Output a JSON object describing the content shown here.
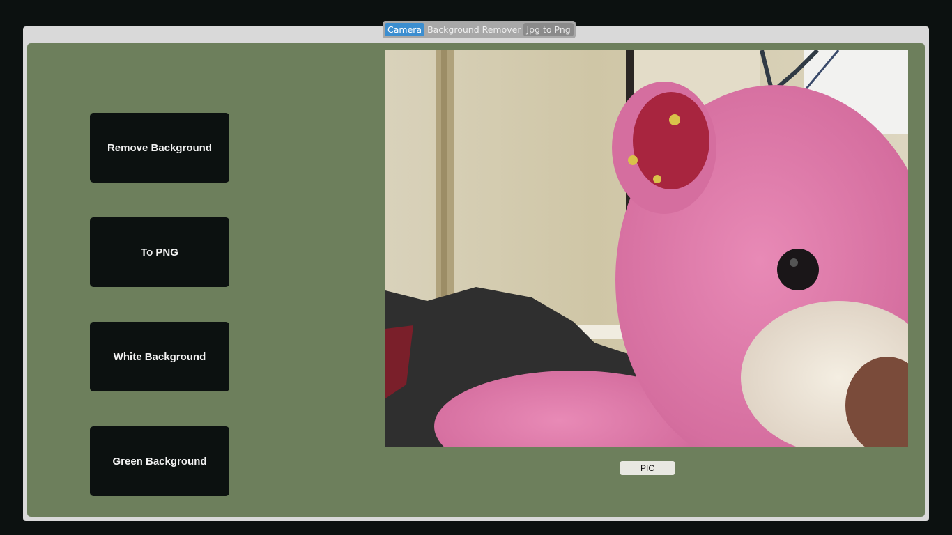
{
  "tabs": [
    {
      "label": "Camera",
      "state": "active"
    },
    {
      "label": "Background Remover",
      "state": "inactive"
    },
    {
      "label": "Jpg to Png",
      "state": "hover"
    }
  ],
  "actions": {
    "remove_background": "Remove Background",
    "to_png": "To PNG",
    "white_background": "White Background",
    "green_background": "Green Background"
  },
  "capture": {
    "pic_label": "PIC"
  },
  "colors": {
    "app_background": "#0c1110",
    "panel_green": "#6d7f5c",
    "frame_gray": "#d9d9d9",
    "active_tab": "#3b8ed0",
    "button_dark": "#0c1110"
  }
}
